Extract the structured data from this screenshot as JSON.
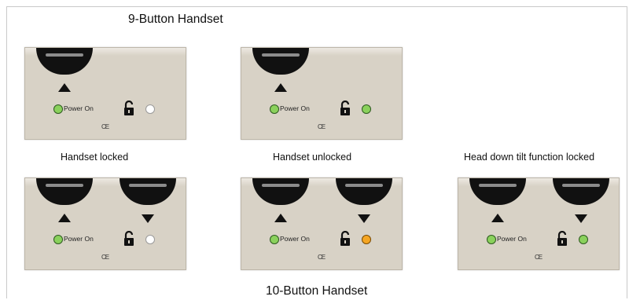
{
  "titles": {
    "nine_button": "9-Button Handset",
    "ten_button": "10-Button Handset"
  },
  "captions": {
    "locked": "Handset locked",
    "unlocked": "Handset unlocked",
    "tilt_locked": "Head down tilt function locked"
  },
  "panel_label": {
    "power_on": "Power On",
    "ce": "CE"
  },
  "panels": [
    {
      "handset": "9-Button",
      "state": "Handset locked",
      "indicator_color": "#ffffff"
    },
    {
      "handset": "9-Button",
      "state": "Handset unlocked",
      "indicator_color": "#8ad15c"
    },
    {
      "handset": "10-Button",
      "state": "Handset locked",
      "indicator_color": "#ffffff"
    },
    {
      "handset": "10-Button",
      "state": "Handset unlocked",
      "indicator_color": "#f5a623"
    },
    {
      "handset": "10-Button",
      "state": "Head down tilt function locked",
      "indicator_color": "#8ad15c"
    }
  ],
  "colors": {
    "panel_bg": "#d8d2c6",
    "power_led": "#8ad15c",
    "led_white": "#ffffff",
    "led_green": "#8ad15c",
    "led_amber": "#f5a623"
  },
  "icons": [
    "lock-icon",
    "up-arrow-icon",
    "down-arrow-icon",
    "ce-mark-icon"
  ]
}
